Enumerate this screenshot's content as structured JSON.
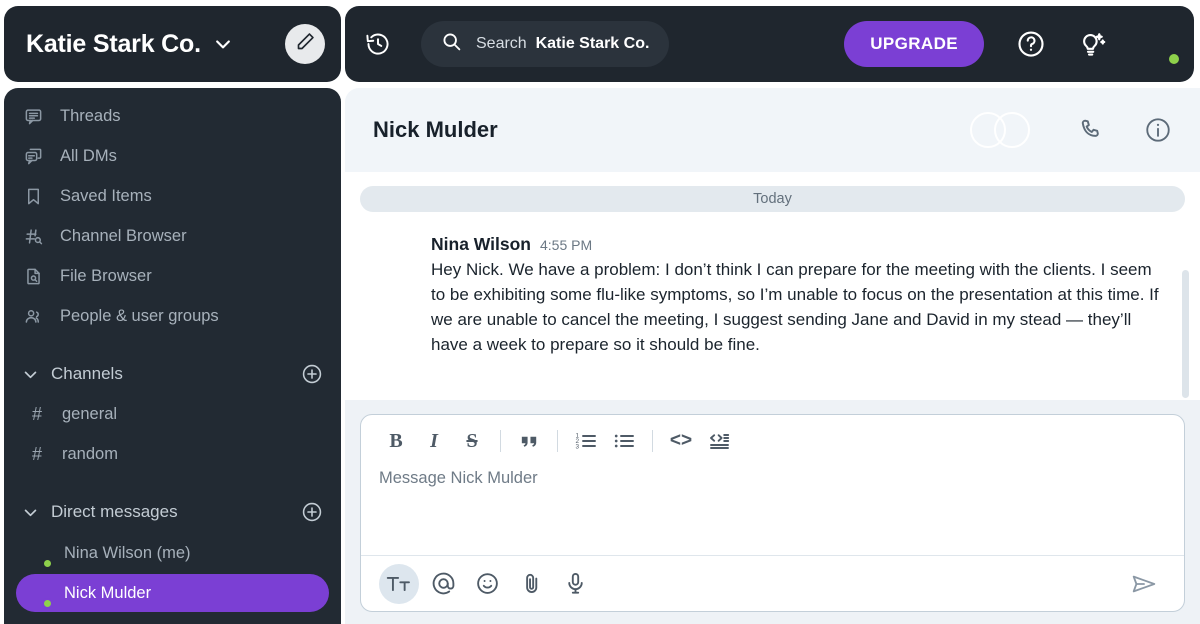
{
  "workspace": {
    "name": "Katie Stark Co.",
    "chevron_icon": "chevron-down-icon",
    "compose_icon": "pencil-icon"
  },
  "sidebar": {
    "nav_items": [
      {
        "label": "Threads",
        "icon": "threads-icon"
      },
      {
        "label": "All DMs",
        "icon": "all-dms-icon"
      },
      {
        "label": "Saved Items",
        "icon": "bookmark-icon"
      },
      {
        "label": "Channel Browser",
        "icon": "channel-browser-icon"
      },
      {
        "label": "File Browser",
        "icon": "file-browser-icon"
      },
      {
        "label": "People & user groups",
        "icon": "people-icon"
      }
    ],
    "channels_section": {
      "title": "Channels",
      "add_icon": "plus-circle-icon",
      "caret_icon": "chevron-down-icon",
      "items": [
        {
          "label": "general",
          "prefix": "#"
        },
        {
          "label": "random",
          "prefix": "#"
        }
      ]
    },
    "dm_section": {
      "title": "Direct messages",
      "add_icon": "plus-circle-icon",
      "caret_icon": "chevron-down-icon",
      "items": [
        {
          "label": "Nina Wilson (me)",
          "presence": "online",
          "active": false
        },
        {
          "label": "Nick Mulder",
          "presence": "online",
          "active": true
        }
      ]
    }
  },
  "topbar": {
    "history_icon": "history-icon",
    "search": {
      "icon": "search-icon",
      "prefix": "Search",
      "scope": "Katie Stark Co."
    },
    "upgrade_label": "UPGRADE",
    "help_icon": "help-circle-icon",
    "ideas_icon": "lightbulb-sparkle-icon",
    "avatar_name": "user-avatar",
    "presence": "online"
  },
  "conversation": {
    "title": "Nick Mulder",
    "member_avatars": [
      "nina-wilson-avatar",
      "nick-mulder-avatar"
    ],
    "call_icon": "phone-icon",
    "info_icon": "info-circle-icon"
  },
  "messages": {
    "day_divider": "Today",
    "items": [
      {
        "author": "Nina Wilson",
        "time": "4:55 PM",
        "avatar": "nina-wilson-avatar",
        "text": "Hey Nick. We have a problem: I don’t think I can prepare for the meeting with the clients. I seem to be exhibiting some flu-like symptoms, so I’m unable to focus on the presentation at this time. If we are unable to cancel the meeting, I suggest sending Jane and David in my stead — they’ll have a week to prepare so it should be fine."
      }
    ]
  },
  "composer": {
    "placeholder": "Message Nick Mulder",
    "format_buttons": [
      {
        "name": "bold",
        "glyph": "B"
      },
      {
        "name": "italic",
        "glyph": "I"
      },
      {
        "name": "strikethrough",
        "glyph": "S"
      },
      {
        "name": "blockquote",
        "glyph": "””"
      },
      {
        "name": "ordered-list",
        "glyph": ""
      },
      {
        "name": "bulleted-list",
        "glyph": ""
      },
      {
        "name": "code",
        "glyph": "<>"
      },
      {
        "name": "code-block",
        "glyph": ""
      }
    ],
    "action_buttons": [
      {
        "name": "formatting-toggle",
        "glyph": "Tt",
        "active": true
      },
      {
        "name": "mention",
        "glyph": "@",
        "active": false
      },
      {
        "name": "emoji",
        "glyph": "☺",
        "active": false
      },
      {
        "name": "attach",
        "glyph": "📎",
        "active": false
      },
      {
        "name": "audio",
        "glyph": "🎙",
        "active": false
      }
    ],
    "send_icon": "send-plane-icon"
  },
  "colors": {
    "sidebar_bg": "#222a33",
    "header_bg": "#1f262e",
    "accent_purple": "#7b3fd4",
    "presence_green": "#8ed14b",
    "composer_bg": "#eef2f6",
    "convo_header_bg": "#f1f5f9"
  }
}
